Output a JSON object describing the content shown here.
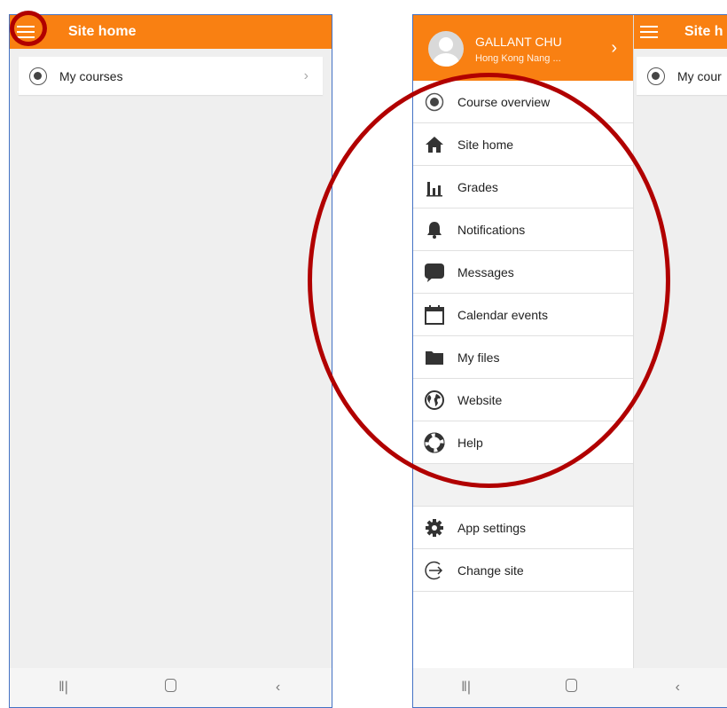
{
  "left_screen": {
    "header": {
      "title": "Site home"
    },
    "list": [
      {
        "label": "My courses"
      }
    ]
  },
  "right_screen": {
    "header": {
      "title": "Site h"
    },
    "background_row": {
      "label": "My cour"
    },
    "drawer": {
      "user": {
        "name": "GALLANT CHU",
        "site": "Hong Kong Nang ..."
      },
      "menu": [
        {
          "label": "Course overview",
          "icon": "course-overview-icon"
        },
        {
          "label": "Site home",
          "icon": "home-icon"
        },
        {
          "label": "Grades",
          "icon": "grades-icon"
        },
        {
          "label": "Notifications",
          "icon": "bell-icon"
        },
        {
          "label": "Messages",
          "icon": "message-icon"
        },
        {
          "label": "Calendar events",
          "icon": "calendar-icon"
        },
        {
          "label": "My files",
          "icon": "folder-icon"
        },
        {
          "label": "Website",
          "icon": "globe-icon"
        },
        {
          "label": "Help",
          "icon": "help-icon"
        }
      ],
      "secondary_menu": [
        {
          "label": "App settings",
          "icon": "gear-icon"
        },
        {
          "label": "Change site",
          "icon": "logout-icon"
        }
      ]
    }
  },
  "colors": {
    "accent": "#f98012",
    "highlight": "#b10000",
    "border": "#4472c4"
  }
}
